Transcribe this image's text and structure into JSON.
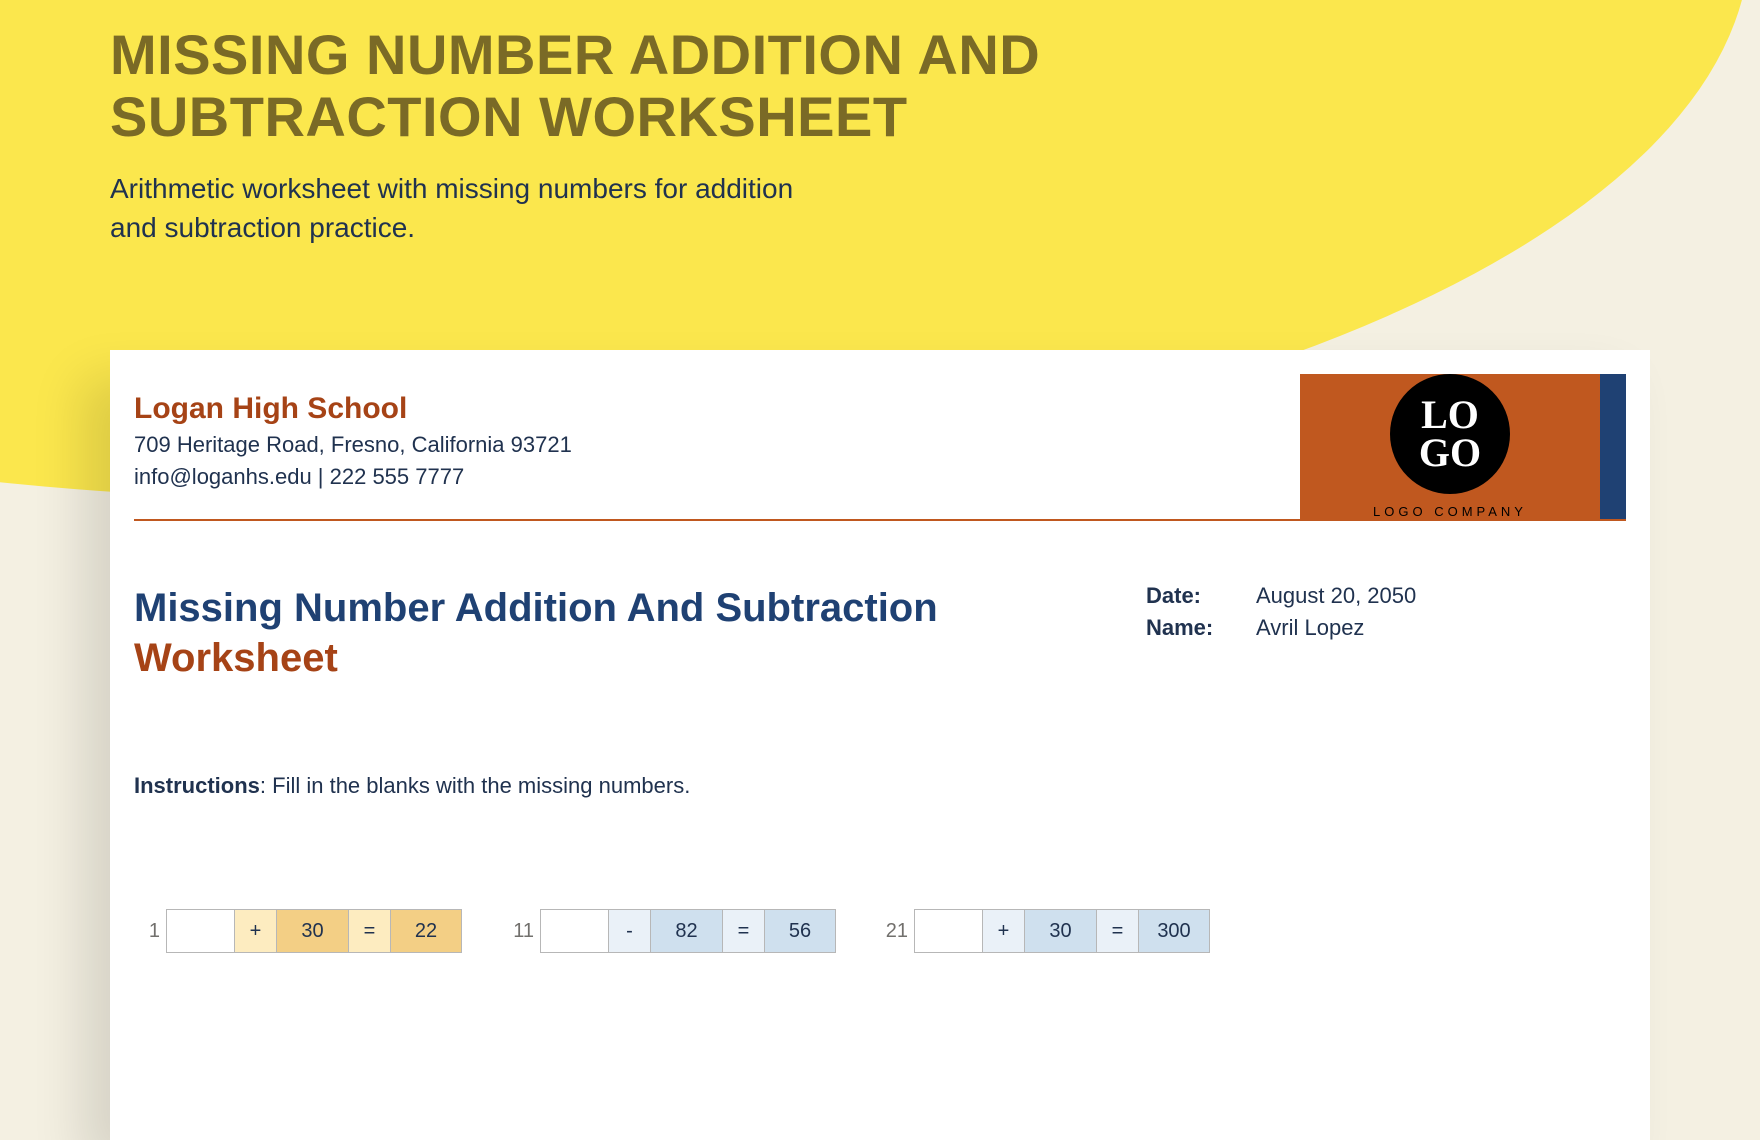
{
  "headline": {
    "title": "MISSING NUMBER ADDITION AND SUBTRACTION WORKSHEET",
    "subtitle": "Arithmetic worksheet with missing numbers for addition and subtraction practice."
  },
  "school": {
    "name": "Logan High School",
    "address": "709 Heritage Road, Fresno, California 93721",
    "contact": "info@loganhs.edu | 222 555 7777"
  },
  "logo": {
    "top": "LO",
    "bottom": "GO",
    "company": "LOGO COMPANY"
  },
  "worksheet": {
    "title_a": "Missing Number Addition And Subtraction ",
    "title_b": "Worksheet",
    "date_label": "Date:",
    "date_value": "August 20, 2050",
    "name_label": "Name:",
    "name_value": "Avril Lopez",
    "instructions_label": "Instructions",
    "instructions_text": ": Fill in the blanks with the missing numbers."
  },
  "problems": [
    {
      "index": "1",
      "theme": "yellow",
      "blank": "",
      "op": "+",
      "operand": "30",
      "eq": "=",
      "result": "22"
    },
    {
      "index": "11",
      "theme": "blue",
      "blank": "",
      "op": "-",
      "operand": "82",
      "eq": "=",
      "result": "56"
    },
    {
      "index": "21",
      "theme": "blue",
      "blank": "",
      "op": "+",
      "operand": "30",
      "eq": "=",
      "result": "300"
    }
  ]
}
